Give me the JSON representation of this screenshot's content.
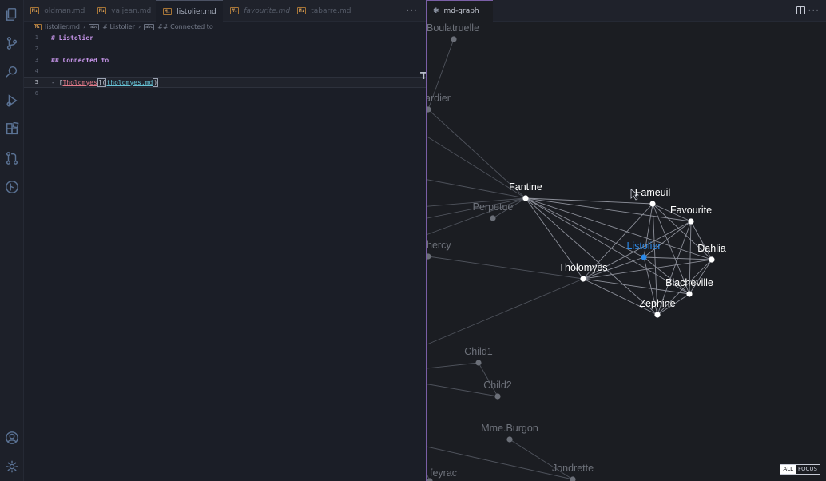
{
  "editor": {
    "tabs": [
      {
        "label": "oldman.md",
        "badge": "M↓",
        "active": false,
        "italic": false
      },
      {
        "label": "valjean.md",
        "badge": "M↓",
        "active": false,
        "italic": false
      },
      {
        "label": "listolier.md",
        "badge": "M↓",
        "active": true,
        "italic": false
      },
      {
        "label": "favourite.md",
        "badge": "M↓",
        "active": false,
        "italic": true
      },
      {
        "label": "tabarre.md",
        "badge": "M↓",
        "active": false,
        "italic": false
      }
    ],
    "more_label": "···",
    "breadcrumb": {
      "file": "listolier.md",
      "symbol1": "# Listolier",
      "symbol2": "## Connected to",
      "badge": "M↓",
      "sym_badge": "abc"
    },
    "lines": [
      {
        "num": "1",
        "text": "# Listolier"
      },
      {
        "num": "2",
        "text": ""
      },
      {
        "num": "3",
        "text": "## Connected to"
      },
      {
        "num": "4",
        "text": ""
      },
      {
        "num": "5",
        "dash": "- ",
        "open_bracket": "[",
        "link_text": "Tholomyes",
        "middle": "](",
        "link_url": "tholomyes.md",
        "close": ")"
      },
      {
        "num": "6",
        "text": ""
      }
    ],
    "ruler_char": "T"
  },
  "graph": {
    "tab_label": "md-graph",
    "tab_icon": "✱",
    "more_label": "···",
    "nodes": [
      {
        "id": "Boulatruelle",
        "label": "Boulatruelle",
        "state": "dim",
        "color": "#6b6f78"
      },
      {
        "id": "Thenardier",
        "label": "ardier",
        "state": "dim",
        "color": "#6b6f78"
      },
      {
        "id": "Fantine",
        "label": "Fantine",
        "state": "bright",
        "color": "#ffffff"
      },
      {
        "id": "Perpetue",
        "label": "Perpetue",
        "state": "dim",
        "color": "#6b6f78"
      },
      {
        "id": "Simplice",
        "label": "hercy",
        "state": "dim",
        "color": "#6b6f78"
      },
      {
        "id": "Fameuil",
        "label": "Fameuil",
        "state": "bright",
        "color": "#ffffff"
      },
      {
        "id": "Favourite",
        "label": "Favourite",
        "state": "bright",
        "color": "#ffffff"
      },
      {
        "id": "Listolier",
        "label": "Listolier",
        "state": "focus",
        "color": "#2b89e8"
      },
      {
        "id": "Dahlia",
        "label": "Dahlia",
        "state": "bright",
        "color": "#ffffff"
      },
      {
        "id": "Tholomyes",
        "label": "Tholomyes",
        "state": "bright",
        "color": "#ffffff"
      },
      {
        "id": "Blacheville",
        "label": "Blacheville",
        "state": "bright",
        "color": "#ffffff"
      },
      {
        "id": "Zephine",
        "label": "Zephine",
        "state": "bright",
        "color": "#ffffff"
      },
      {
        "id": "Child1",
        "label": "Child1",
        "state": "dim",
        "color": "#6b6f78"
      },
      {
        "id": "Child2",
        "label": "Child2",
        "state": "dim",
        "color": "#6b6f78"
      },
      {
        "id": "MmeBurgon",
        "label": "Mme.Burgon",
        "state": "dim",
        "color": "#6b6f78"
      },
      {
        "id": "Jondrette",
        "label": "Jondrette",
        "state": "dim",
        "color": "#6b6f78"
      },
      {
        "id": "Courfeyrac",
        "label": "feyrac",
        "state": "dim",
        "color": "#6b6f78"
      }
    ],
    "controls": {
      "all_label": "ALL",
      "focus_label": "FOCUS"
    }
  },
  "colors": {
    "accent": "#7a5fa6",
    "focus_node": "#2b89e8",
    "heading": "#c594e8",
    "link_text": "#e47b8a",
    "link_url": "#67c3d6",
    "md_badge": "#e6a85a"
  }
}
